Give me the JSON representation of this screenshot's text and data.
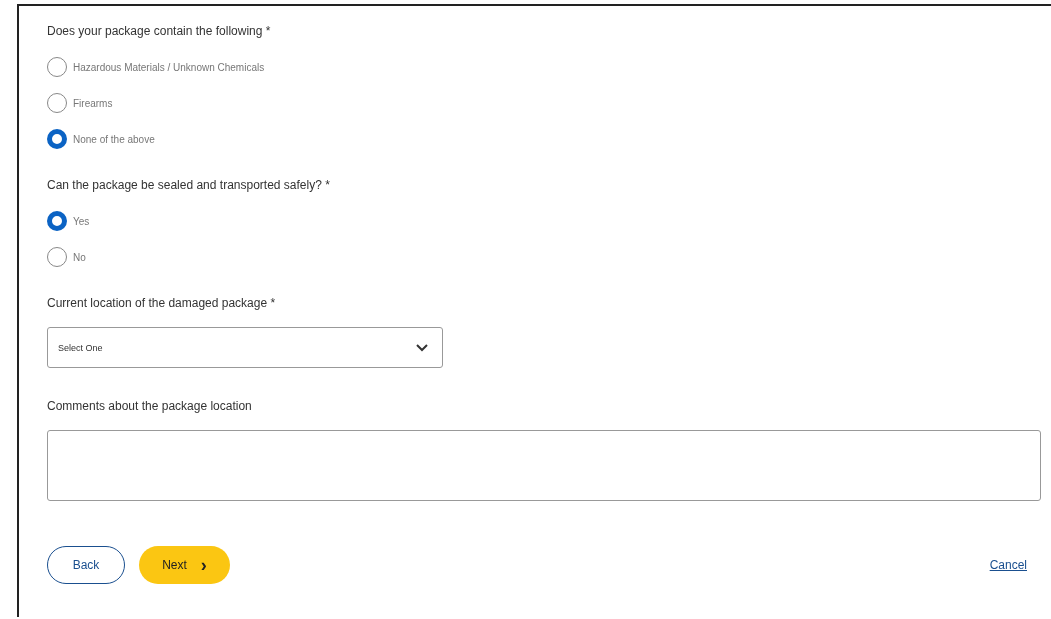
{
  "questions": [
    {
      "label": "Does your package contain the following *",
      "options": [
        {
          "label": "Hazardous Materials / Unknown Chemicals",
          "selected": false
        },
        {
          "label": "Firearms",
          "selected": false
        },
        {
          "label": "None of the above",
          "selected": true
        }
      ]
    },
    {
      "label": "Can the package be sealed and transported safely? *",
      "options": [
        {
          "label": "Yes",
          "selected": true
        },
        {
          "label": "No",
          "selected": false
        }
      ]
    }
  ],
  "location": {
    "label": "Current location of the damaged package *",
    "value": "Select One"
  },
  "comments": {
    "label": "Comments about the package location"
  },
  "buttons": {
    "back": "Back",
    "next": "Next",
    "next_icon": "›",
    "cancel": "Cancel"
  }
}
